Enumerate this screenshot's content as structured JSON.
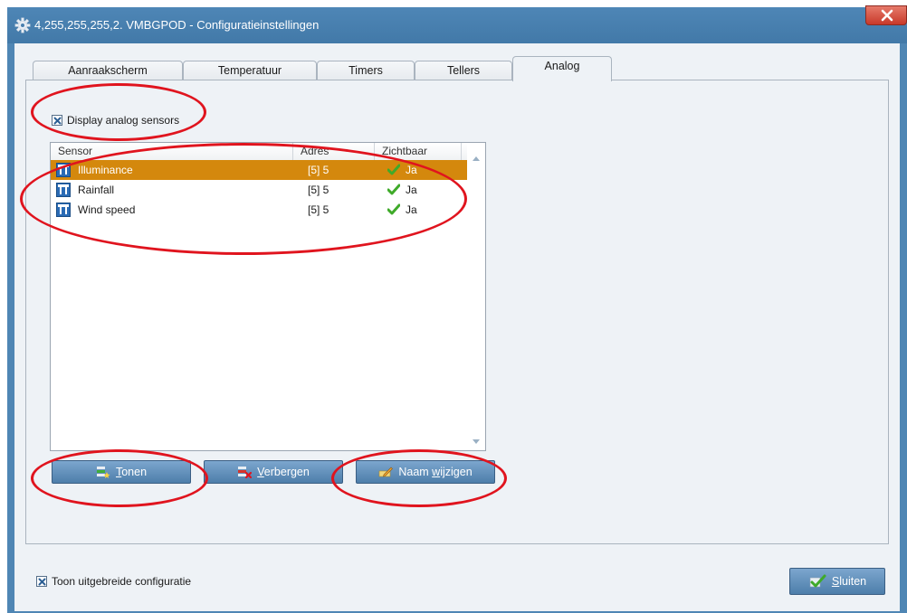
{
  "window": {
    "title": "4,255,255,255,2. VMBGPOD - Configuratieinstellingen",
    "gear_icon": "gear-icon",
    "close_icon": "close-icon"
  },
  "tabs": [
    {
      "label": "Aanraakscherm",
      "active": false
    },
    {
      "label": "Temperatuur",
      "active": false
    },
    {
      "label": "Timers",
      "active": false
    },
    {
      "label": "Tellers",
      "active": false
    },
    {
      "label": "Analog",
      "active": true
    }
  ],
  "analog": {
    "display_checkbox_label": "Display analog sensors",
    "display_checked": true,
    "columns": {
      "sensor": "Sensor",
      "adres": "Adres",
      "zichtbaar": "Zichtbaar"
    },
    "rows": [
      {
        "sensor": "Illuminance",
        "adres": "[5] 5",
        "zichtbaar": "Ja",
        "selected": true
      },
      {
        "sensor": "Rainfall",
        "adres": "[5] 5",
        "zichtbaar": "Ja",
        "selected": false
      },
      {
        "sensor": "Wind speed",
        "adres": "[5] 5",
        "zichtbaar": "Ja",
        "selected": false
      }
    ],
    "buttons": {
      "show": {
        "label_underlined": "T",
        "label_rest": "onen"
      },
      "hide": {
        "label_underlined": "V",
        "label_rest": "erbergen"
      },
      "rename": {
        "label_prefix": "Naam ",
        "label_underlined": "w",
        "label_rest": "ijzigen"
      }
    }
  },
  "footer": {
    "extended_config_label": "Toon uitgebreide configuratie",
    "extended_checked": true,
    "close_button": {
      "label_underlined": "S",
      "label_rest": "luiten"
    }
  },
  "colors": {
    "selection": "#d4880d",
    "annotation_ring": "#e0141e",
    "title_bar": "#4f86b4",
    "button": "#5b8ab5",
    "checkmark": "#3faa2a"
  }
}
